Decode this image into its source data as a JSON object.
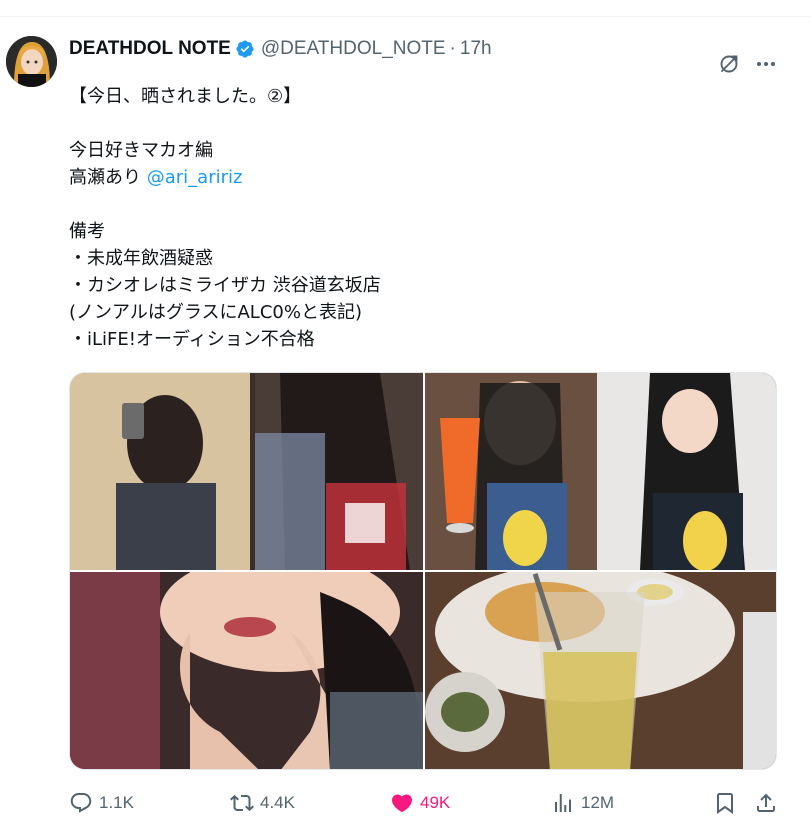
{
  "author": {
    "display_name": "DEATHDOL NOTE",
    "handle": "@DEATHDOL_NOTE",
    "separator": "·",
    "time": "17h",
    "verified": true,
    "verified_color": "#1d9bf0"
  },
  "tweet": {
    "lines": [
      "【今日、晒されました。②】",
      "",
      "今日好きマカオ編",
      "高瀬あり ",
      "",
      "備考",
      "・未成年飲酒疑惑",
      "・カシオレはミライザカ 渋谷道玄坂店",
      "(ノンアルはグラスにALC0%と表記)",
      "・iLiFE!オーディション不合格"
    ],
    "mention": "@ari_aririz",
    "mention_color": "#1d9bf0"
  },
  "media": {
    "photos": [
      {
        "name": "mirror-selfie-photo"
      },
      {
        "name": "cocktail-selfie-photo"
      },
      {
        "name": "face-closeup-photo"
      },
      {
        "name": "drink-on-table-photo"
      }
    ]
  },
  "actions": {
    "replies": "1.1K",
    "reposts": "4.4K",
    "likes": "49K",
    "views": "12M",
    "like_color": "#f91880",
    "icon_color": "#536471"
  }
}
